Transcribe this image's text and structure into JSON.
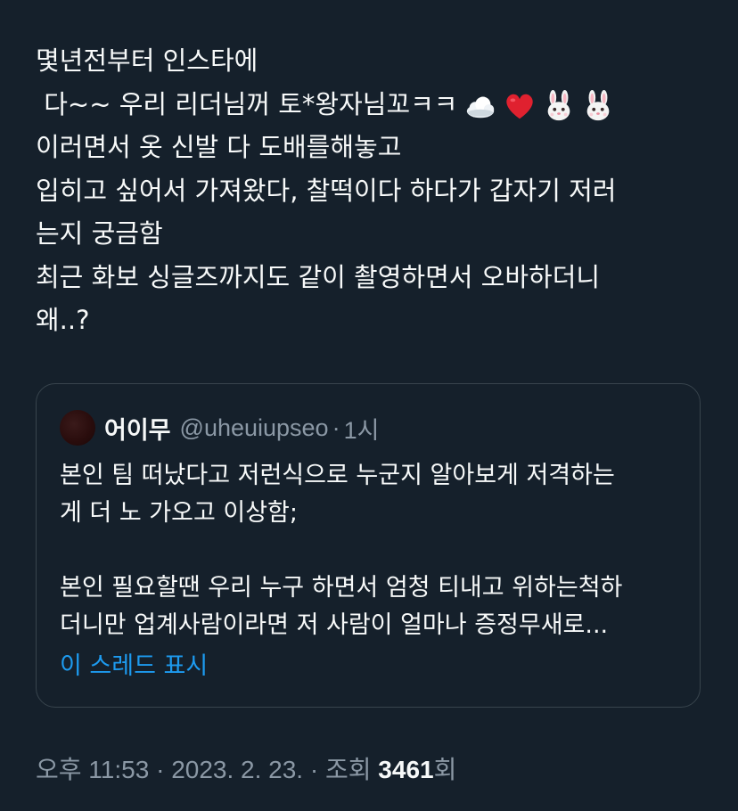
{
  "tweet": {
    "lines": [
      "몇년전부터 인스타에",
      " 다~~ 우리 리더님꺼 토*왕자님꼬ㅋㅋ",
      "이러면서 옷 신발 다 도배를해놓고",
      "입히고 싶어서 가져왔다, 찰떡이다 하다가 갑자기 저러",
      "는지 궁금함",
      "최근 화보 싱글즈까지도 같이 촬영하면서 오바하더니",
      "왜..?"
    ],
    "emojis": [
      "cloud-icon",
      "red-heart-icon",
      "rabbit-face-icon",
      "rabbit-face-icon"
    ]
  },
  "quote": {
    "name": "어이무",
    "handle": "@uheuiupseo",
    "separator": "·",
    "time": "1시",
    "lines": [
      "본인 팀 떠났다고 저런식으로 누군지 알아보게 저격하는",
      "게 더 노 가오고 이상함;",
      "",
      "본인 필요할땐 우리 누구 하면서 엄청 티내고 위하는척하",
      "더니만 업계사람이라면 저 사람이 얼마나 증정무새로..."
    ],
    "show_thread": "이 스레드 표시"
  },
  "meta": {
    "time": "오후 11:53",
    "sep1": " · ",
    "date": "2023. 2. 23.",
    "sep2": " · ",
    "views_label": "조회 ",
    "views_count": "3461",
    "views_suffix": "회"
  },
  "colors": {
    "background": "#15202b",
    "text": "#f7f9f9",
    "secondary": "#8b98a5",
    "link": "#1d9bf0",
    "border": "#38444d"
  }
}
